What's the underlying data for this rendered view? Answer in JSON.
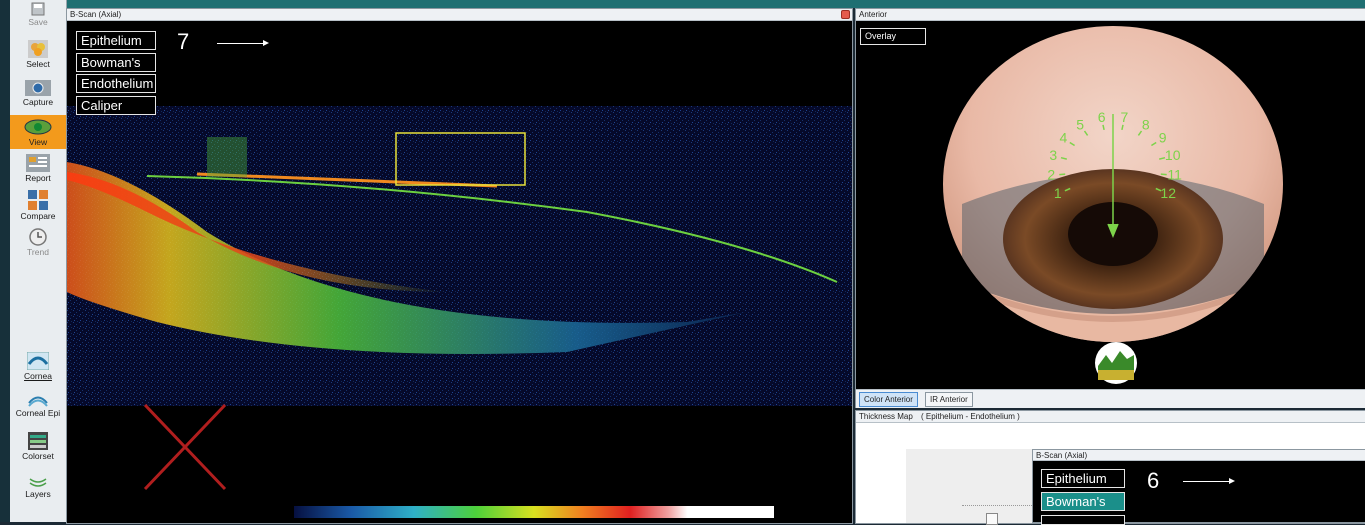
{
  "toolbar": {
    "items": [
      {
        "label": "Save",
        "icon": "floppy-disk-icon",
        "state": "disabled"
      },
      {
        "label": "Select",
        "icon": "patients-icon",
        "state": "normal"
      },
      {
        "label": "Capture",
        "icon": "camera-icon",
        "state": "normal"
      },
      {
        "label": "View",
        "icon": "eye-icon",
        "state": "active"
      },
      {
        "label": "Report",
        "icon": "report-icon",
        "state": "normal"
      },
      {
        "label": "Compare",
        "icon": "compare-icon",
        "state": "normal"
      },
      {
        "label": "Trend",
        "icon": "clock-icon",
        "state": "disabled"
      }
    ],
    "modes": [
      {
        "label": "Cornea",
        "icon": "cornea-icon",
        "selected": true
      },
      {
        "label": "Corneal Epi",
        "icon": "corneal-epi-icon",
        "selected": false
      },
      {
        "label": "Colorset",
        "icon": "colorset-icon",
        "selected": false
      },
      {
        "label": "Layers",
        "icon": "layers-icon",
        "selected": false
      }
    ]
  },
  "bscan": {
    "title": "B-Scan (Axial)",
    "layers": [
      "Epithelium",
      "Bowman's",
      "Endothelium",
      "Caliper"
    ],
    "annotation_number": "7"
  },
  "anterior": {
    "title": "Anterior",
    "overlay_label": "Overlay",
    "clock_numbers": [
      "1",
      "2",
      "3",
      "4",
      "5",
      "6",
      "7",
      "8",
      "9",
      "10",
      "11",
      "12"
    ],
    "tabs": [
      "Color Anterior",
      "IR Anterior"
    ]
  },
  "thickness": {
    "title": "Thickness Map",
    "subtitle": "( Epithelium - Endothelium )",
    "inner_title": "B-Scan (Axial)",
    "layers": [
      "Epithelium",
      "Bowman's"
    ],
    "annotation_number": "6"
  },
  "colors": {
    "accent": "#f39a1c",
    "overlay_green": "#7dd34a",
    "selected_layer": "#1b8f8a",
    "crop_box": "#e8e13a",
    "red_x": "#b01e1e"
  }
}
